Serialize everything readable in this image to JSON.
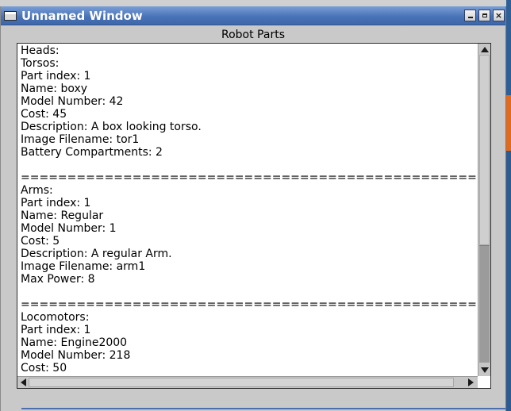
{
  "window": {
    "title": "Unnamed Window",
    "icons": {
      "app": "window-icon",
      "minimize": "minimize-icon",
      "maximize": "maximize-icon",
      "close": "close-icon"
    },
    "close_glyph": "×"
  },
  "group": {
    "label": "Robot Parts"
  },
  "text_lines": [
    "Heads:",
    "Torsos:",
    "Part index: 1",
    "Name: boxy",
    "Model Number: 42",
    "Cost: 45",
    "Description: A box looking torso.",
    "Image Filename: tor1",
    "Battery Compartments: 2",
    "",
    "==================================================",
    "Arms:",
    "Part index: 1",
    "Name: Regular",
    "Model Number: 1",
    "Cost: 5",
    "Description: A regular Arm.",
    "Image Filename: arm1",
    "Max Power: 8",
    "",
    "==================================================",
    "Locomotors:",
    "Part index: 1",
    "Name: Engine2000",
    "Model Number: 218",
    "Cost: 50"
  ],
  "colors": {
    "titlebar": "#4a74b8",
    "title_text": "#ffffff",
    "background": "#c9c9c9"
  }
}
